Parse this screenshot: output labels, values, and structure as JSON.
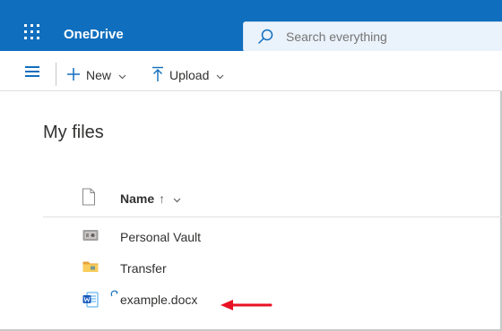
{
  "app": {
    "name": "OneDrive",
    "accent_color": "#106ebe",
    "icons": {
      "waffle": "app-launcher-icon",
      "search": "search-icon"
    }
  },
  "search": {
    "placeholder": "Search everything"
  },
  "commandbar": {
    "new_label": "New",
    "upload_label": "Upload",
    "icons": {
      "menu": "hamburger-icon",
      "new": "plus-icon",
      "upload": "upload-icon",
      "dropdown": "chevron-down-icon"
    }
  },
  "main": {
    "title": "My files",
    "list": {
      "name_header": "Name",
      "sort_indicator": "↑",
      "items": [
        {
          "name": "Personal Vault",
          "icon": "vault-icon"
        },
        {
          "name": "Transfer",
          "icon": "folder-icon"
        },
        {
          "name": "example.docx",
          "icon": "word-doc-icon",
          "status_icon": "syncing-icon"
        }
      ]
    }
  },
  "annotation": {
    "icon": "red-arrow",
    "color": "#e81123"
  }
}
